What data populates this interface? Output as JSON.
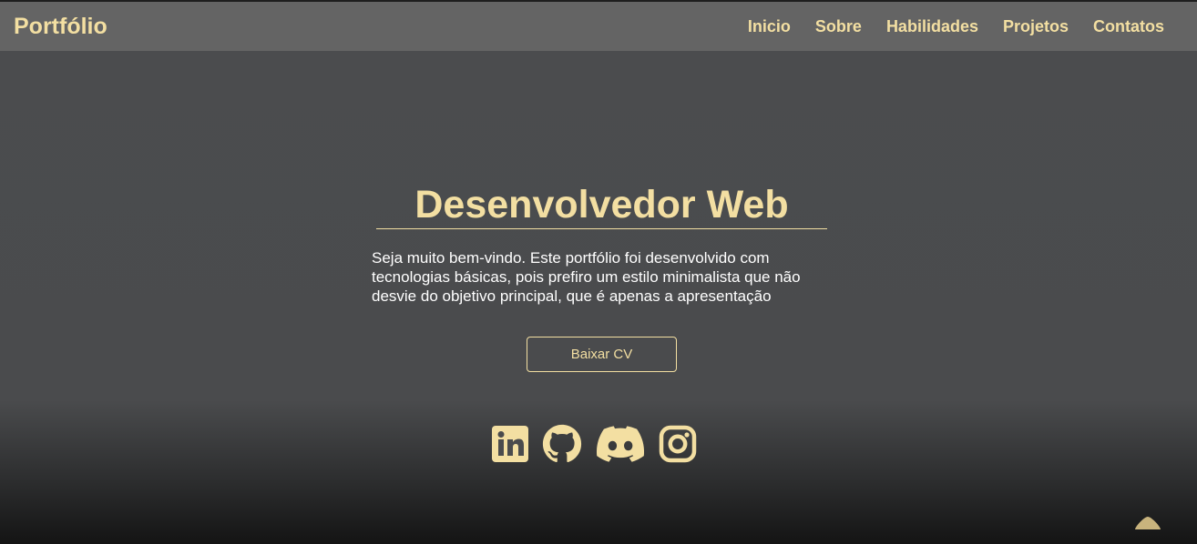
{
  "navbar": {
    "brand": "Portfólio",
    "links": [
      "Inicio",
      "Sobre",
      "Habilidades",
      "Projetos",
      "Contatos"
    ]
  },
  "hero": {
    "title": "Desenvolvedor Web",
    "description": "Seja muito bem-vindo. Este portfólio foi desenvolvido com tecnologias básicas, pois prefiro um estilo minimalista que não desvie do objetivo principal, que é apenas a apresentação",
    "cv_button": "Baixar CV"
  },
  "social_icons": [
    "linkedin-icon",
    "github-icon",
    "discord-icon",
    "instagram-icon"
  ],
  "scroll_top_icon": "chevron-up-icon",
  "colors": {
    "accent": "#f3dfa2",
    "navbar": "#646464",
    "background": "#4b4c4e",
    "text": "#ffffff"
  }
}
